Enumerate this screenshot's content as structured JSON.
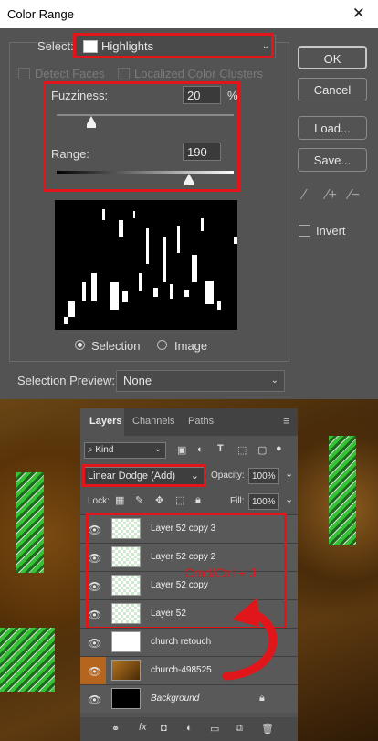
{
  "dialog": {
    "title": "Color Range",
    "select_label": "Select:",
    "select_value": "Highlights",
    "detect_faces": "Detect Faces",
    "localized": "Localized Color Clusters",
    "fuzziness_label": "Fuzziness:",
    "fuzziness_value": "20",
    "fuzziness_unit": "%",
    "fuzziness_level": 0.195,
    "range_label": "Range:",
    "range_value": "190",
    "range_level": 0.745,
    "selection_label": "Selection",
    "image_label": "Image",
    "preview_label": "Selection Preview:",
    "preview_value": "None",
    "buttons": {
      "ok": "OK",
      "cancel": "Cancel",
      "load": "Load...",
      "save": "Save..."
    },
    "invert_label": "Invert",
    "accent_red": "#e0161b"
  },
  "layers_panel": {
    "tabs": [
      "Layers",
      "Channels",
      "Paths"
    ],
    "kind_label": "Kind",
    "blend_mode": "Linear Dodge (Add)",
    "opacity_label": "Opacity:",
    "opacity_value": "100%",
    "lock_label": "Lock:",
    "fill_label": "Fill:",
    "fill_value": "100%",
    "layers": [
      {
        "name": "Layer 52 copy 3"
      },
      {
        "name": "Layer 52 copy 2"
      },
      {
        "name": "Layer 52 copy"
      },
      {
        "name": "Layer 52"
      },
      {
        "name": "church retouch"
      },
      {
        "name": "church-498525"
      },
      {
        "name": "Background"
      }
    ],
    "annotation": "Cmd/Ctrl + J"
  }
}
